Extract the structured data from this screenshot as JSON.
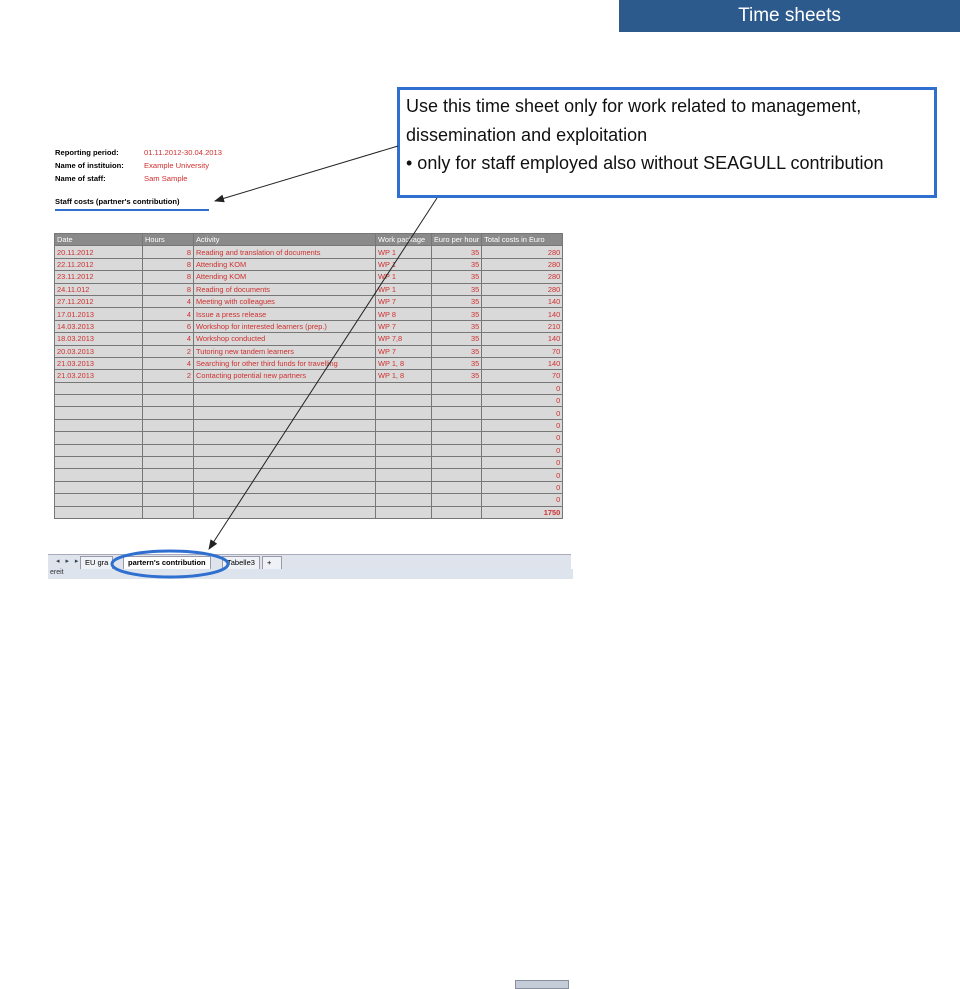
{
  "header": {
    "title": "Time sheets"
  },
  "callout": {
    "line1": "Use this time sheet only for work related to management, dissemination and exploitation",
    "line2": "• only for staff employed also without SEAGULL contribution"
  },
  "spreadsheet": {
    "reporting_period_label": "Reporting period:",
    "reporting_period_value": "01.11.2012-30.04.2013",
    "institution_label": "Name of instituion:",
    "institution_value": "Example University",
    "staff_label": "Name of staff:",
    "staff_value": "Sam Sample",
    "section_title": "Staff costs (partner's contribution)",
    "columns": [
      "Date",
      "Hours",
      "Activity",
      "Work package",
      "Euro per hour",
      "Total costs in Euro"
    ],
    "rows": [
      [
        "20.11.2012",
        "8",
        "Reading and translation of documents",
        "WP 1",
        "35",
        "280"
      ],
      [
        "22.11.2012",
        "8",
        "Attending KOM",
        "WP 1",
        "35",
        "280"
      ],
      [
        "23.11.2012",
        "8",
        "Attending KOM",
        "WP 1",
        "35",
        "280"
      ],
      [
        "24.11.012",
        "8",
        "Reading of documents",
        "WP 1",
        "35",
        "280"
      ],
      [
        "27.11.2012",
        "4",
        "Meeting with colleagues",
        "WP 7",
        "35",
        "140"
      ],
      [
        "17.01.2013",
        "4",
        "Issue a press release",
        "WP 8",
        "35",
        "140"
      ],
      [
        "14.03.2013",
        "6",
        "Workshop for interested learners (prep.)",
        "WP 7",
        "35",
        "210"
      ],
      [
        "18.03.2013",
        "4",
        "Workshop conducted",
        "WP 7,8",
        "35",
        "140"
      ],
      [
        "20.03.2013",
        "2",
        "Tutoring new tandem learners",
        "WP 7",
        "35",
        "70"
      ],
      [
        "21.03.2013",
        "4",
        "Searching for other third funds for travelling",
        "WP 1, 8",
        "35",
        "140"
      ],
      [
        "21.03.2013",
        "2",
        "Contacting potential new partners",
        "WP 1, 8",
        "35",
        "70"
      ],
      [
        "",
        "",
        "",
        "",
        "",
        "0"
      ],
      [
        "",
        "",
        "",
        "",
        "",
        "0"
      ],
      [
        "",
        "",
        "",
        "",
        "",
        "0"
      ],
      [
        "",
        "",
        "",
        "",
        "",
        "0"
      ],
      [
        "",
        "",
        "",
        "",
        "",
        "0"
      ],
      [
        "",
        "",
        "",
        "",
        "",
        "0"
      ],
      [
        "",
        "",
        "",
        "",
        "",
        "0"
      ],
      [
        "",
        "",
        "",
        "",
        "",
        "0"
      ],
      [
        "",
        "",
        "",
        "",
        "",
        "0"
      ],
      [
        "",
        "",
        "",
        "",
        "",
        "0"
      ],
      [
        "",
        "",
        "",
        "",
        "",
        "1750"
      ]
    ],
    "tabs": [
      "EU gra",
      "partern's contribution",
      "Tabelle3"
    ],
    "status_text": "ereit"
  },
  "colors": {
    "accent": "#2f6fd0",
    "title_bg": "#2d5a8c",
    "red_text": "#d03030",
    "header_gray": "#8a8a8a"
  }
}
